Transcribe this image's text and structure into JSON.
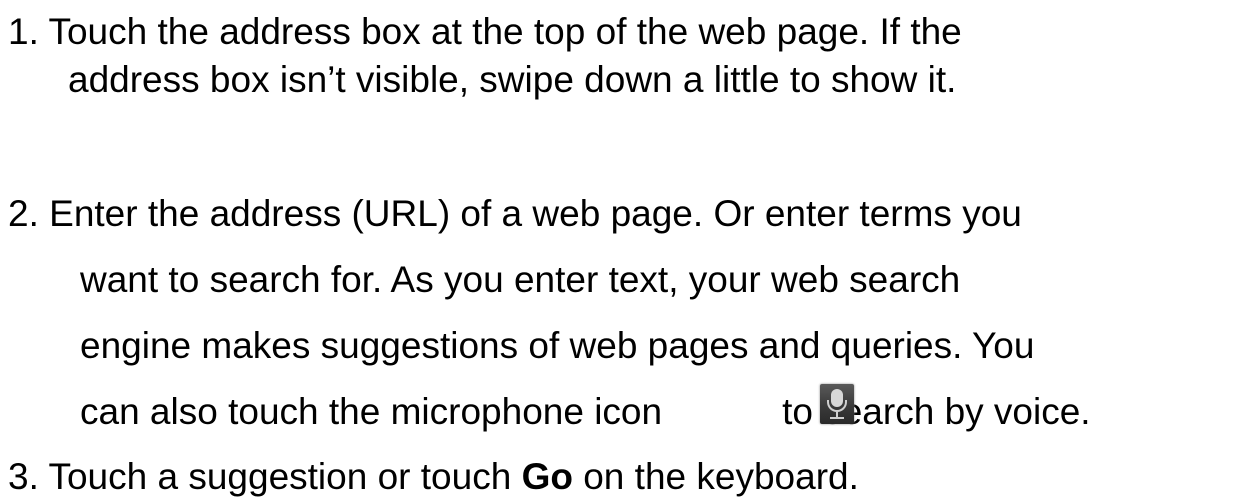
{
  "steps": [
    {
      "line1": "1. Touch the address box at the top of the web page. If the",
      "line2": "address box isn’t visible, swipe down a little to show it."
    },
    {
      "line1": "2. Enter the address (URL) of a web page. Or enter terms you",
      "line2": "want to search for. As you enter text, your web search",
      "line3": "engine makes suggestions of web pages and queries. You",
      "line4_before_icon": "can also touch the microphone icon",
      "line4_after_icon": "to search by voice.",
      "icon": "microphone-icon"
    },
    {
      "prefix": "3. Touch a suggestion or touch ",
      "bold": "Go",
      "suffix": " on the keyboard."
    }
  ]
}
